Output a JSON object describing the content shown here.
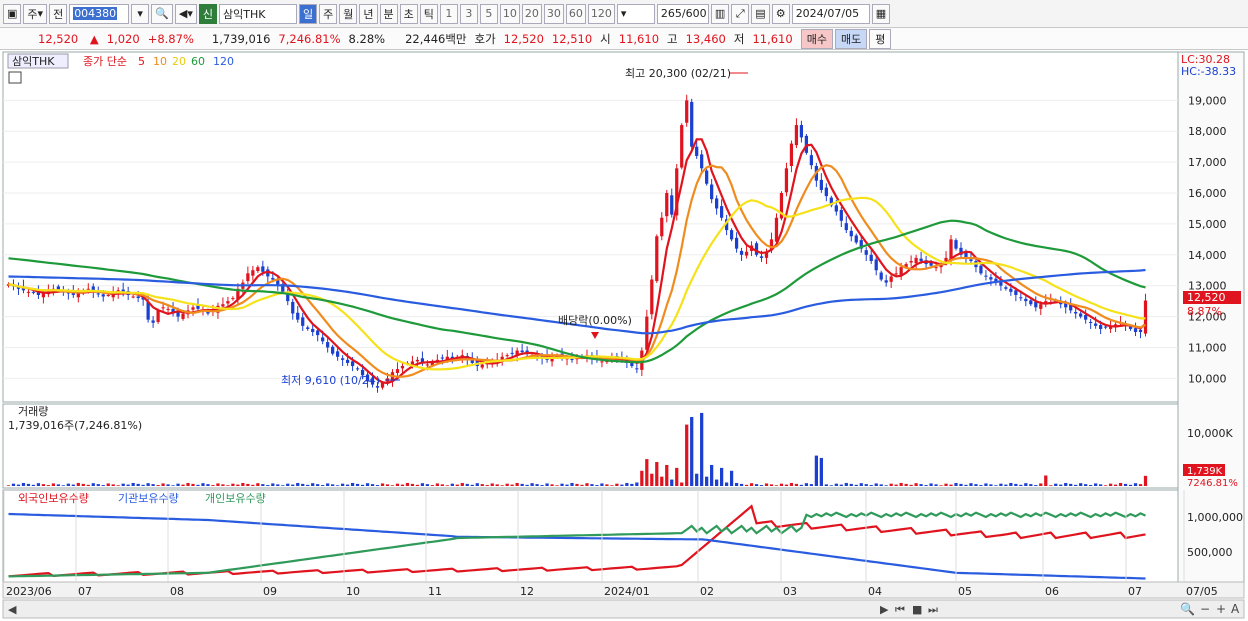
{
  "toolbar": {
    "mode1": "주",
    "mode2": "전",
    "code": "004380",
    "badge": "신",
    "name": "삼익THK",
    "periods": [
      "일",
      "주",
      "월",
      "년",
      "분",
      "초",
      "틱"
    ],
    "active_period": "일",
    "intervals": [
      "1",
      "3",
      "5",
      "10",
      "20",
      "30",
      "60",
      "120"
    ],
    "count": "265",
    "count_total": "/600",
    "date": "2024/07/05"
  },
  "quote": {
    "price": "12,520",
    "arrow": "▲",
    "change": "1,020",
    "change_pct": "+8.87%",
    "volume": "1,739,016",
    "volume_pct": "7,246.81%",
    "turnover_rate": "8.28%",
    "amount": "22,446백만",
    "bid_ask_label": "호가",
    "ask": "12,520",
    "bid": "12,510",
    "open_label": "시",
    "open": "11,610",
    "high_label": "고",
    "high": "13,460",
    "low_label": "저",
    "low": "11,610",
    "buy_label": "매수",
    "sell_label": "매도",
    "avg_label": "평"
  },
  "price_panel": {
    "name_label": "삼익THK",
    "ma_title": "종가 단순",
    "lc": "LC:30.28",
    "hc": "HC:-38.33",
    "high_note": "최고 20,300 (02/21)",
    "low_note": "최저 9,610 (10/24)",
    "dividend_note": "배당락(0.00%)",
    "last_price_tag": "12,520",
    "last_pct_tag": "8.87%"
  },
  "volume_panel": {
    "title": "거래량",
    "value": "1,739,016주(7,246.81%)",
    "tag": "1,739K",
    "tag_pct": "7246.81%"
  },
  "holdings_panel": {
    "legend": [
      "외국인보유수량",
      "기관보유수량",
      "개인보유수량"
    ]
  },
  "colors": {
    "up": "#e0141e",
    "down": "#1a3fd1",
    "ma5": "#e0141e",
    "ma10": "#f08c1e",
    "ma20": "#f5e21a",
    "ma60": "#1f9a3a",
    "ma120": "#2a5ce0",
    "foreign": "#e0141e",
    "institution": "#2a5ce0",
    "individual": "#2f9a5a"
  },
  "chart_data": [
    {
      "type": "candlestick",
      "title": "삼익THK",
      "series": [
        {
          "name": "5"
        },
        {
          "name": "10"
        },
        {
          "name": "20"
        },
        {
          "name": "60"
        },
        {
          "name": "120"
        }
      ],
      "ylim": [
        9300,
        20500
      ],
      "y_ticks": [
        10000,
        11000,
        12000,
        13000,
        14000,
        15000,
        16000,
        17000,
        18000,
        19000
      ],
      "y_tick_labels": [
        "10,000",
        "11,000",
        "12,000",
        "13,000",
        "14,000",
        "15,000",
        "16,000",
        "17,000",
        "18,000",
        "19,000"
      ],
      "x_ticks": [
        "2023/06",
        "07",
        "08",
        "09",
        "10",
        "11",
        "12",
        "2024/01",
        "02",
        "03",
        "04",
        "05",
        "06",
        "07",
        "07/05"
      ],
      "close": [
        13050,
        12980,
        12900,
        12850,
        12800,
        12780,
        12700,
        12750,
        12820,
        12900,
        12860,
        12800,
        12750,
        12700,
        12780,
        12850,
        12900,
        12800,
        12720,
        12650,
        12700,
        12800,
        12850,
        12750,
        12700,
        12650,
        12600,
        12550,
        11900,
        11800,
        12200,
        12300,
        12250,
        12100,
        12000,
        12100,
        12200,
        12300,
        12250,
        12200,
        12100,
        12200,
        12350,
        12400,
        12500,
        12600,
        12900,
        13100,
        13400,
        13500,
        13600,
        13450,
        13300,
        13200,
        13000,
        12800,
        12500,
        12100,
        11900,
        11700,
        11600,
        11500,
        11400,
        11200,
        11000,
        10800,
        10700,
        10600,
        10500,
        10400,
        10300,
        10100,
        9900,
        9800,
        9700,
        9850,
        10000,
        10200,
        10300,
        10400,
        10500,
        10550,
        10600,
        10500,
        10450,
        10550,
        10600,
        10650,
        10700,
        10650,
        10700,
        10750,
        10600,
        10500,
        10400,
        10450,
        10500,
        10550,
        10600,
        10700,
        10750,
        10800,
        10900,
        10850,
        10800,
        10750,
        10700,
        10650,
        10600,
        10700,
        10750,
        10700,
        10650,
        10600,
        10650,
        10700,
        10750,
        10650,
        10600,
        10550,
        10600,
        10650,
        10700,
        10600,
        10500,
        10400,
        10300,
        10900,
        12000,
        13200,
        14600,
        15200,
        16000,
        15300,
        16800,
        18200,
        19000,
        17500,
        17200,
        16800,
        16300,
        15800,
        15500,
        15200,
        14800,
        14500,
        14200,
        14000,
        14100,
        14300,
        14000,
        13900,
        14100,
        14500,
        15200,
        16000,
        16800,
        17600,
        18200,
        17800,
        17300,
        16900,
        16400,
        16100,
        15900,
        15600,
        15400,
        15100,
        14800,
        14600,
        14400,
        14200,
        14000,
        13800,
        13500,
        13200,
        13100,
        13300,
        13400,
        13600,
        13700,
        13800,
        13900,
        13800,
        13700,
        13650,
        13600,
        13700,
        13900,
        14500,
        14200,
        14000,
        13900,
        13800,
        13600,
        13400,
        13300,
        13200,
        13100,
        13000,
        12900,
        12800,
        12700,
        12600,
        12500,
        12400,
        12300,
        12400,
        12500,
        12600,
        12500,
        12400,
        12300,
        12200,
        12100,
        12000,
        11900,
        11800,
        11700,
        11600,
        11650,
        11700,
        11750,
        11800,
        11700,
        11600,
        11500,
        11500,
        12520
      ],
      "ma60": "green",
      "ma120": "blue"
    },
    {
      "type": "bar",
      "title": "거래량",
      "ylabel_ticks": [
        "10,000K"
      ],
      "spikes": [
        {
          "date": "2024/02/20",
          "value": 11800
        },
        {
          "date": "2024/02/21",
          "value": 12500
        },
        {
          "date": "2024/02/19",
          "value": 10500
        },
        {
          "date": "2024/03/12",
          "value": 5200
        },
        {
          "date": "2024/07/05",
          "value": 1739
        }
      ]
    },
    {
      "type": "line",
      "title": "보유수량",
      "series": [
        {
          "name": "외국인보유수량"
        },
        {
          "name": "기관보유수량"
        },
        {
          "name": "개인보유수량"
        }
      ],
      "y_ticks": [
        500000,
        1000000
      ],
      "y_tick_labels": [
        "500,000",
        "1,000,000"
      ]
    }
  ]
}
